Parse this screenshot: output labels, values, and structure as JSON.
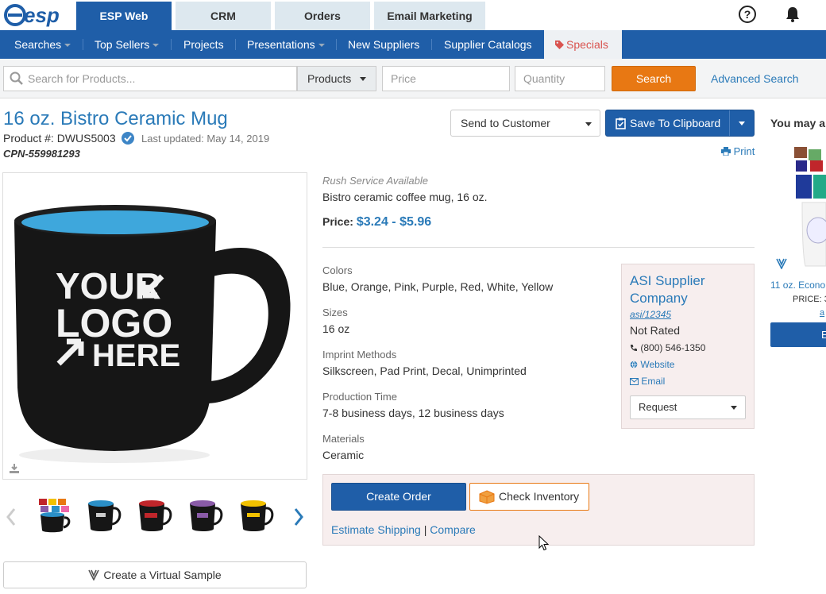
{
  "brand": {
    "logo_text": "esp"
  },
  "top_tabs": [
    {
      "label": "ESP Web",
      "active": true
    },
    {
      "label": "CRM",
      "active": false
    },
    {
      "label": "Orders",
      "active": false
    },
    {
      "label": "Email Marketing",
      "active": false
    }
  ],
  "top_icons": [
    "help-icon",
    "bell-icon"
  ],
  "nav": {
    "items": [
      {
        "label": "Searches",
        "dropdown": true
      },
      {
        "label": "Top Sellers",
        "dropdown": true
      },
      {
        "label": "Projects",
        "dropdown": false
      },
      {
        "label": "Presentations",
        "dropdown": true
      },
      {
        "label": "New Suppliers",
        "dropdown": false
      },
      {
        "label": "Supplier Catalogs",
        "dropdown": false
      }
    ],
    "specials": "Specials"
  },
  "search": {
    "placeholder": "Search for Products...",
    "type_selected": "Products",
    "price_placeholder": "Price",
    "quantity_placeholder": "Quantity",
    "button": "Search",
    "advanced": "Advanced Search"
  },
  "product": {
    "title": "16 oz. Bistro Ceramic Mug",
    "number": "Product #: DWUS5003",
    "last_updated": "Last updated: May 14, 2019",
    "cpn": "CPN-559981293",
    "rush": "Rush Service Available",
    "description": "Bistro ceramic coffee mug, 16 oz.",
    "price_label": "Price:",
    "price_value": "$3.24 - $5.96",
    "attributes": [
      {
        "label": "Colors",
        "value": "Blue, Orange, Pink, Purple, Red, White, Yellow"
      },
      {
        "label": "Sizes",
        "value": "16 oz"
      },
      {
        "label": "Imprint Methods",
        "value": "Silkscreen, Pad Print, Decal, Unimprinted"
      },
      {
        "label": "Production Time",
        "value": "7-8 business days, 12 business days"
      },
      {
        "label": "Materials",
        "value": "Ceramic"
      }
    ],
    "image_text": [
      "YOUR",
      "LOGO",
      "HERE"
    ],
    "thumbnail_colors": [
      "multi",
      "#2b8fc7",
      "#c0262b",
      "#8a5ba8",
      "#f2c100"
    ]
  },
  "actions": {
    "send_to_customer": "Send to Customer",
    "save_to_clipboard": "Save To Clipboard",
    "print": "Print",
    "create_order": "Create Order",
    "check_inventory": "Check Inventory",
    "estimate_shipping": "Estimate Shipping",
    "separator": "|",
    "compare": "Compare",
    "virtual_sample": "Create a Virtual Sample"
  },
  "supplier": {
    "name": "ASI Supplier Company",
    "asi": "asi/12345",
    "rating": "Not Rated",
    "phone": "(800) 546-1350",
    "website": "Website",
    "email": "Email",
    "request": "Request"
  },
  "related": {
    "heading": "You may a",
    "item_name": "11 oz. Econo",
    "item_price": "PRICE: 3",
    "item_link": "a",
    "button": "E"
  },
  "colors": {
    "primary": "#1f5ea8",
    "accent": "#e87813",
    "link": "#2a7ab8",
    "specials": "#d9534f"
  }
}
